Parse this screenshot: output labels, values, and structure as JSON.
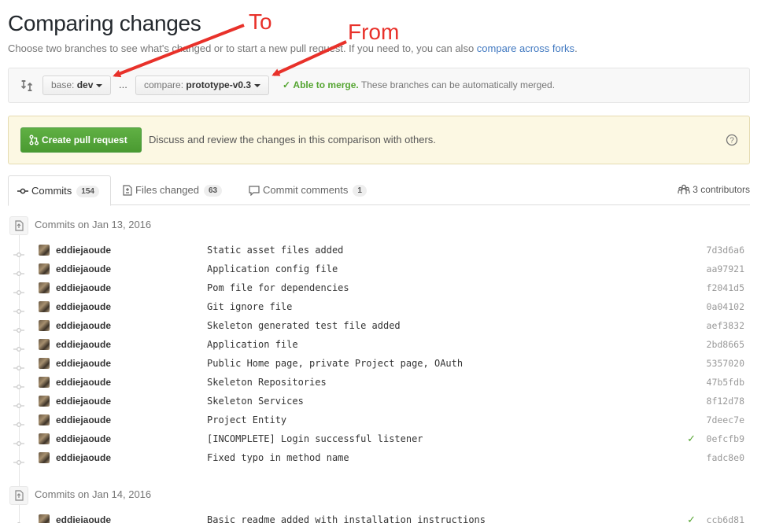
{
  "header": {
    "title": "Comparing changes",
    "subtitle_prefix": "Choose two branches to see what's changed or to start a new pull request. If you need to, you can also ",
    "subtitle_link": "compare across forks",
    "subtitle_suffix": "."
  },
  "range": {
    "base_label": "base:",
    "base_value": "dev",
    "separator": "...",
    "compare_label": "compare:",
    "compare_value": "prototype-v0.3",
    "merge_status": "Able to merge.",
    "merge_detail": "These branches can be automatically merged."
  },
  "pull_request": {
    "button_label": "Create pull request",
    "description": "Discuss and review the changes in this comparison with others."
  },
  "tabs": [
    {
      "label": "Commits",
      "count": "154"
    },
    {
      "label": "Files changed",
      "count": "63"
    },
    {
      "label": "Commit comments",
      "count": "1"
    }
  ],
  "contributors": "3 contributors",
  "groups": [
    {
      "heading": "Commits on Jan 13, 2016",
      "commits": [
        {
          "author": "eddiejaoude",
          "message": "Static asset files added",
          "sha": "7d3d6a6",
          "verified": false
        },
        {
          "author": "eddiejaoude",
          "message": "Application config file",
          "sha": "aa97921",
          "verified": false
        },
        {
          "author": "eddiejaoude",
          "message": "Pom file for dependencies",
          "sha": "f2041d5",
          "verified": false
        },
        {
          "author": "eddiejaoude",
          "message": "Git ignore file",
          "sha": "0a04102",
          "verified": false
        },
        {
          "author": "eddiejaoude",
          "message": "Skeleton generated test file added",
          "sha": "aef3832",
          "verified": false
        },
        {
          "author": "eddiejaoude",
          "message": "Application file",
          "sha": "2bd8665",
          "verified": false
        },
        {
          "author": "eddiejaoude",
          "message": "Public Home page, private Project page, OAuth",
          "sha": "5357020",
          "verified": false
        },
        {
          "author": "eddiejaoude",
          "message": "Skeleton Repositories",
          "sha": "47b5fdb",
          "verified": false
        },
        {
          "author": "eddiejaoude",
          "message": "Skeleton Services",
          "sha": "8f12d78",
          "verified": false
        },
        {
          "author": "eddiejaoude",
          "message": "Project Entity",
          "sha": "7deec7e",
          "verified": false
        },
        {
          "author": "eddiejaoude",
          "message": "[INCOMPLETE] Login successful listener",
          "sha": "0efcfb9",
          "verified": true
        },
        {
          "author": "eddiejaoude",
          "message": "Fixed typo in method name",
          "sha": "fadc8e0",
          "verified": false
        }
      ]
    },
    {
      "heading": "Commits on Jan 14, 2016",
      "commits": [
        {
          "author": "eddiejaoude",
          "message": "Basic readme added with installation instructions",
          "sha": "ccb6d81",
          "verified": true
        }
      ]
    }
  ],
  "annotations": {
    "to": "To",
    "from": "From",
    "color": "#e8312a"
  },
  "colors": {
    "accent_link": "#4078c0",
    "success": "#55a532",
    "pr_button": "#55a532",
    "notice_bg": "#fcf8e3"
  }
}
